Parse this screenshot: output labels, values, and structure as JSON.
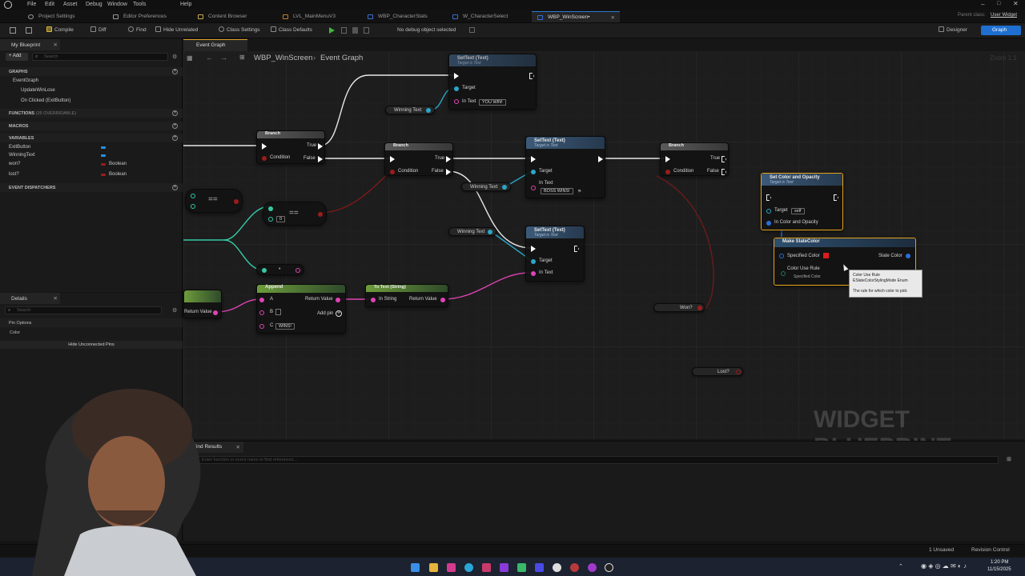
{
  "menu": [
    "File",
    "Edit",
    "Asset",
    "Debug",
    "Window",
    "Tools",
    "Help"
  ],
  "top_right": {
    "parent_class_label": "Parent class:",
    "parent_class_value": "User Widget"
  },
  "doc_tabs": {
    "project_settings": "Project Settings",
    "editor_preferences": "Editor Preferences",
    "content_browser": "Content Browser",
    "lvl": "LVL_MainMenuV3",
    "char_stats": "WBP_CharacterStats",
    "char_select": "W_CharacterSelect",
    "win_screen": "WBP_WinScreen•"
  },
  "toolbar": {
    "compile": "Compile",
    "diff": "Diff",
    "find": "Find",
    "hide_unrelated": "Hide Unrelated",
    "class_settings": "Class Settings",
    "class_defaults": "Class Defaults",
    "debug_select": "No debug object selected",
    "designer": "Designer",
    "graph": "Graph"
  },
  "my_blueprint": {
    "tab": "My Blueprint",
    "add": "+ Add",
    "search_placeholder": "Search",
    "graphs_header": "GRAPHS",
    "event_graph": "EventGraph",
    "update_win_lose": "UpdateWinLose",
    "on_clicked": "On Clicked (ExitButton)",
    "functions_header": "FUNCTIONS",
    "functions_overridable": "(26 OVERRIDABLE)",
    "macros_header": "MACROS",
    "variables_header": "VARIABLES",
    "variables": [
      {
        "name": "ExitButton",
        "type": "",
        "color": "#2a8fe0"
      },
      {
        "name": "WinningText",
        "type": "",
        "color": "#2a8fe0"
      },
      {
        "name": "won?",
        "type": "Boolean",
        "color": "#9b1c1c"
      },
      {
        "name": "lost?",
        "type": "Boolean",
        "color": "#9b1c1c"
      }
    ],
    "dispatchers_header": "EVENT DISPATCHERS"
  },
  "details": {
    "tab": "Details",
    "search_placeholder": "Search",
    "pin_options": "Pin Options",
    "color": "Color",
    "hide_unconnected": "Hide Unconnected Pins"
  },
  "graph": {
    "tab": "Event Graph",
    "crumb_bp": "WBP_WinScreen",
    "crumb_graph": "Event Graph",
    "zoom": "Zoom 1:1"
  },
  "nodes": {
    "settext_top": {
      "title": "SetText (Text)",
      "sub": "Target is Text",
      "target": "Target",
      "in_text": "In Text",
      "value": "YOU WIN!"
    },
    "settext_mid": {
      "title": "SetText (Text)",
      "sub": "Target is Text",
      "target": "Target",
      "in_text": "In Text",
      "value": "BOSS WINS!"
    },
    "settext_low": {
      "title": "SetText (Text)",
      "sub": "Target is Text",
      "target": "Target",
      "in_text": "In Text"
    },
    "branch1": {
      "title": "Branch",
      "condition": "Condition",
      "true": "True",
      "false": "False"
    },
    "branch2": {
      "title": "Branch",
      "condition": "Condition",
      "true": "True",
      "false": "False"
    },
    "branch3": {
      "title": "Branch",
      "condition": "Condition",
      "true": "True",
      "false": "False"
    },
    "set_color": {
      "title": "Set Color and Opacity",
      "sub": "Target is Text",
      "target": "Target",
      "target_val": "self",
      "in_color": "In Color and Opacity"
    },
    "make_slate": {
      "title": "Make SlateColor",
      "specified": "Specified Color",
      "slate": "Slate Color",
      "rule": "Color Use Rule",
      "rule_val": "Specified Color"
    },
    "append": {
      "title": "Append",
      "a": "A",
      "b": "B",
      "c": "C",
      "c_val": "WINS!",
      "return": "Return Value",
      "add_pin": "Add pin"
    },
    "to_text": {
      "title": "To Text (String)",
      "in_string": "In String",
      "return": "Return Value"
    },
    "left_return": "Return Value",
    "eq1": "==",
    "eq2": "==",
    "eq2_val": "0",
    "winning_text": "Winning Text",
    "won": "Won?",
    "lost": "Lost?"
  },
  "tooltip": {
    "line1": "Color Use Rule",
    "line2": "ESlateColorStylingMode Enum",
    "line3": "The rule for which color to pick"
  },
  "watermark": "WIDGET BLUEPRINT",
  "find_results": {
    "tab": "Find Results",
    "placeholder": "Enter function or event name to find references..."
  },
  "status": {
    "unsaved": "1 Unsaved",
    "revision": "Revision Control"
  },
  "clock": {
    "time": "1:20 PM",
    "date": "11/15/2025"
  }
}
